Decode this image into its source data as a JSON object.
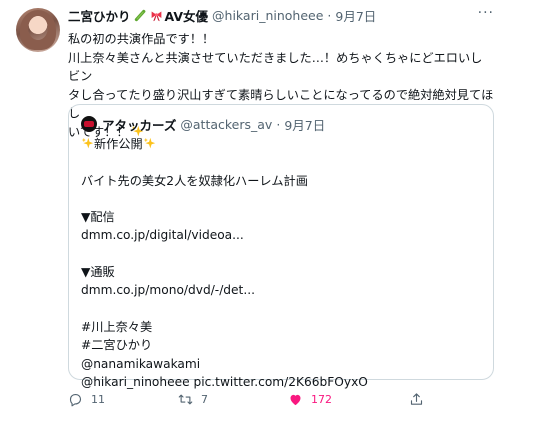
{
  "tweet": {
    "author_name": "二宮ひかり",
    "author_name_suffix": "AV女優",
    "handle": "@hikari_ninoheee",
    "separator": "·",
    "date": "9月7日",
    "more_label": "···",
    "text_lines": [
      "私の初の共演作品です！！",
      "川上奈々美さんと共演させていただきました…！めちゃくちゃにどエロいしビン",
      "タし合ってたり盛り沢山すぎて素晴らしいことになってるので絶対絶対見てほし",
      "いです！！"
    ]
  },
  "quote": {
    "author_name": "アタッカーズ",
    "handle": "@attackers_av",
    "separator": "·",
    "date": "9月7日",
    "lines": [
      "新作公開",
      "",
      "バイト先の美女2人を奴隷化ハーレム計画",
      "",
      "▼配信",
      "dmm.co.jp/digital/videoa...",
      "",
      "▼通販",
      "dmm.co.jp/mono/dvd/-/det...",
      "",
      "#川上奈々美",
      "#二宮ひかり",
      "@nanamikawakami",
      "@hikari_ninoheee pic.twitter.com/2K66bFOyxO"
    ]
  },
  "actions": {
    "reply_count": "11",
    "retweet_count": "7",
    "like_count": "172"
  },
  "colors": {
    "text": "#0f1419",
    "secondary": "#536471",
    "like": "#f91880",
    "border": "#cfd9de"
  },
  "icons": [
    "cucumber-emoji-icon",
    "ribbon-emoji-icon",
    "sparkles-emoji-icon",
    "reply-icon",
    "retweet-icon",
    "heart-icon",
    "share-icon",
    "more-icon"
  ]
}
